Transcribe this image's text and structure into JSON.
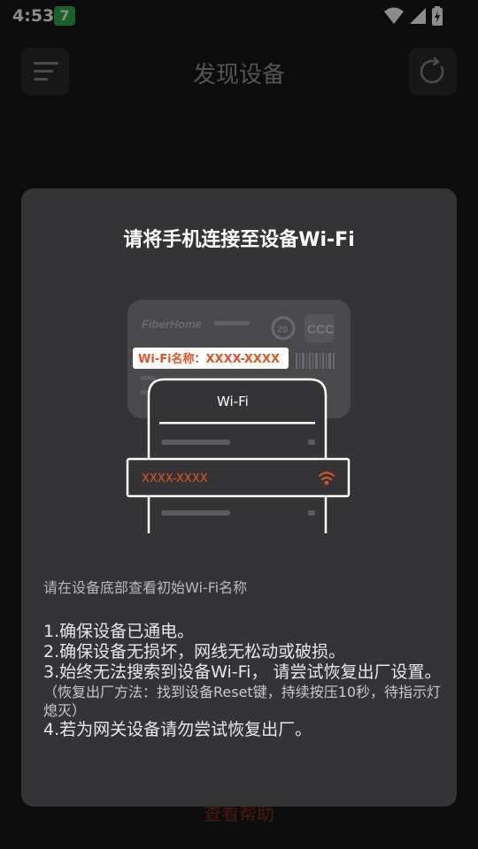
{
  "status_bar": {
    "time": "4:53",
    "badge": "7"
  },
  "header": {
    "title": "发现设备"
  },
  "help_link": "查看帮助",
  "dialog": {
    "title": "请将手机连接至设备Wi-Fi",
    "illustration": {
      "brand": "FiberHome",
      "cert_number": "20",
      "cert_mark": "CCC",
      "sticker_label": "Wi-Fi名称：XXXX-XXXX",
      "phone_header": "Wi-Fi",
      "network_name": "XXXX-XXXX"
    },
    "hint": "请在设备底部查看初始Wi-Fi名称",
    "steps": {
      "s1": "1.确保设备已通电。",
      "s2": "2.确保设备无损坏，网线无松动或破损。",
      "s3": "3.始终无法搜索到设备Wi-Fi， 请尝试恢复出厂设置。",
      "s3_note": "（恢复出厂方法：找到设备Reset键，持续按压10秒，待指示灯熄灭）",
      "s4": "4.若为网关设备请勿尝试恢复出厂。"
    }
  },
  "colors": {
    "accent": "#e8531e",
    "badge": "#28b34a",
    "dialog_bg": "#343437"
  }
}
